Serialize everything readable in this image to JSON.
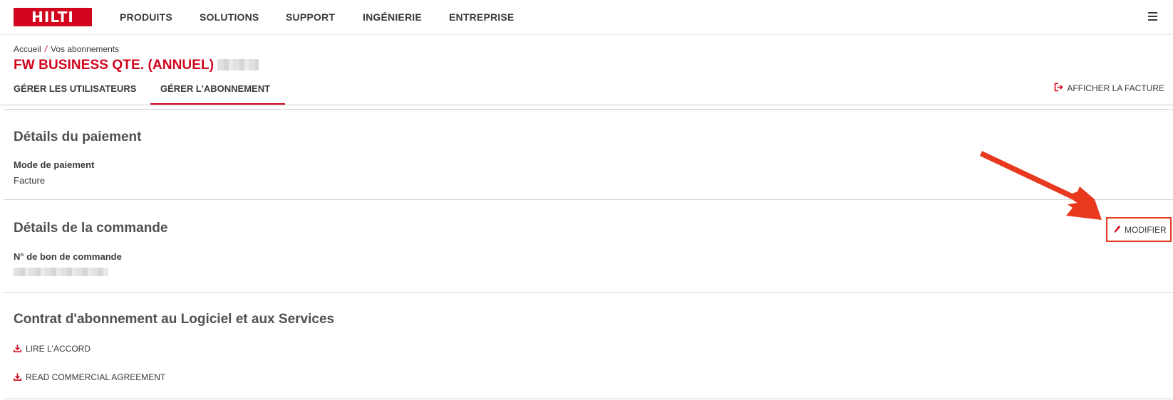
{
  "header": {
    "logo_text": "HILTI",
    "nav": [
      "PRODUITS",
      "SOLUTIONS",
      "SUPPORT",
      "INGÉNIERIE",
      "ENTREPRISE"
    ],
    "menu_icon": "hamburger-menu-icon"
  },
  "breadcrumb": {
    "home": "Accueil",
    "separator": "/",
    "current": "Vos abonnements"
  },
  "page": {
    "title": "FW BUSINESS QTE. (ANNUEL)"
  },
  "tabs": {
    "items": [
      {
        "label": "GÉRER LES UTILISATEURS",
        "active": false
      },
      {
        "label": "GÉRER L'ABONNEMENT",
        "active": true
      }
    ],
    "invoice_link": "AFFICHER LA FACTURE",
    "invoice_icon": "external-sign-out-icon"
  },
  "payment": {
    "title": "Détails du paiement",
    "mode_label": "Mode de paiement",
    "mode_value": "Facture"
  },
  "order": {
    "title": "Détails de la commande",
    "po_label": "N° de bon de commande",
    "edit_label": "MODIFIER",
    "edit_icon": "pencil-icon"
  },
  "contract": {
    "title": "Contrat d'abonnement au Logiciel et aux Services",
    "links": [
      "LIRE L'ACCORD",
      "READ COMMERCIAL AGREEMENT"
    ],
    "link_icon": "download-icon"
  },
  "colors": {
    "brand_red": "#d2051e",
    "annotation_red": "#e8391f",
    "text": "#3b3a3c"
  }
}
